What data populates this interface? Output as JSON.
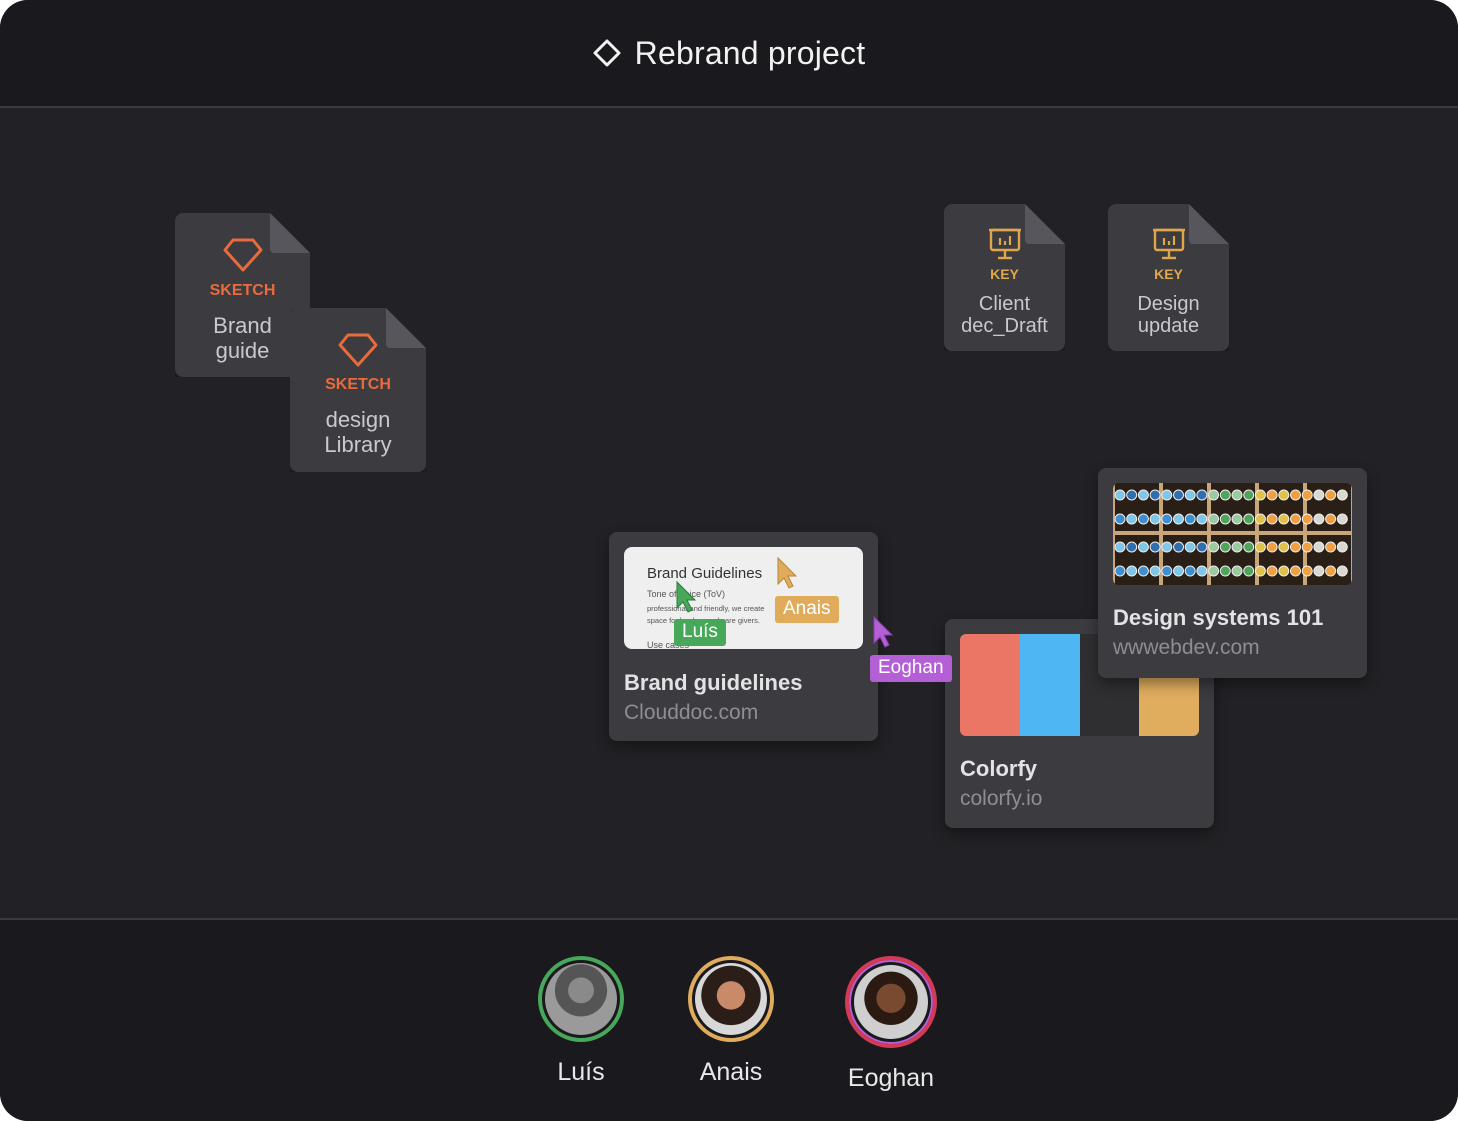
{
  "project": {
    "title": "Rebrand project",
    "icon": "diamond-icon"
  },
  "files": [
    {
      "type": "SKETCH",
      "name_line1": "Brand",
      "name_line2": "guide",
      "icon": "sketch-diamond-icon",
      "accent": "#e96b3c"
    },
    {
      "type": "SKETCH",
      "name_line1": "design",
      "name_line2": "Library",
      "icon": "sketch-diamond-icon",
      "accent": "#e96b3c"
    },
    {
      "type": "KEY",
      "name_line1": "Client",
      "name_line2": "dec_Draft",
      "icon": "keynote-presentation-icon",
      "accent": "#e0a64c"
    },
    {
      "type": "KEY",
      "name_line1": "Design",
      "name_line2": "update",
      "icon": "keynote-presentation-icon",
      "accent": "#e0a64c"
    }
  ],
  "links": {
    "brand_guidelines": {
      "title": "Brand guidelines",
      "domain": "Clouddoc.com",
      "preview": {
        "heading": "Brand Guidelines",
        "line1": "Tone of Voice (ToV)",
        "line2": "professional and friendly, we create",
        "line3": "space for leaders and care givers.",
        "line4": "Use cases"
      }
    },
    "colorfy": {
      "title": "Colorfy",
      "domain": "colorfy.io",
      "swatches": [
        "#ec7665",
        "#4eb6f2",
        "#2f2f31",
        "#e0ad5e"
      ]
    },
    "design_systems": {
      "title": "Design systems 101",
      "domain": "wwwebdev.com"
    }
  },
  "cursors": [
    {
      "name": "Luís",
      "color": "#47a85a"
    },
    {
      "name": "Anais",
      "color": "#e0ac5b"
    },
    {
      "name": "Eoghan",
      "color": "#b45fd6"
    }
  ],
  "collaborators": [
    {
      "name": "Luís",
      "ring": "#47a85a"
    },
    {
      "name": "Anais",
      "ring": "#e0ac5b"
    },
    {
      "name": "Eoghan",
      "ring": "#d43a55"
    }
  ]
}
